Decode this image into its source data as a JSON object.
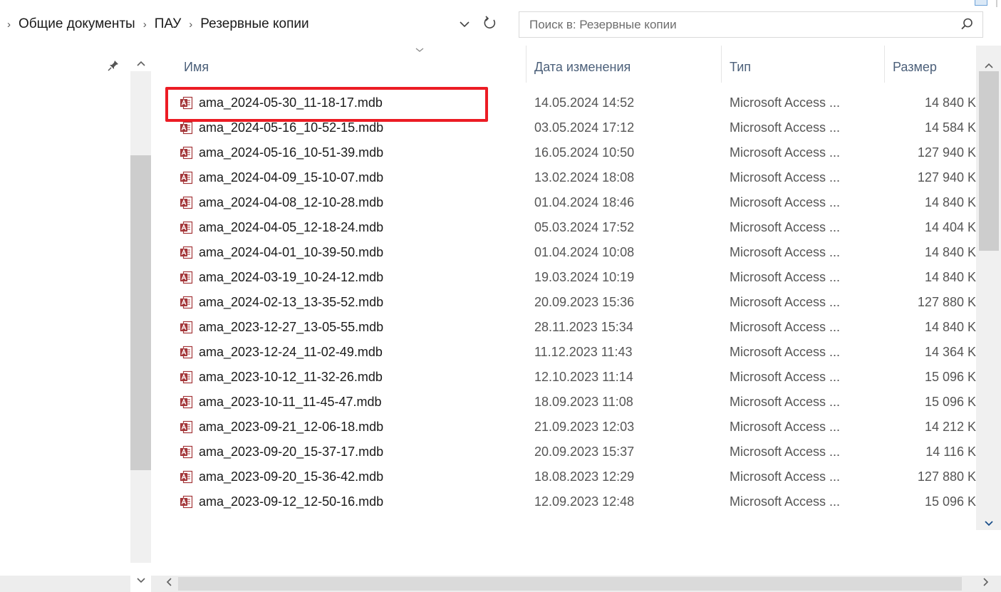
{
  "breadcrumb": {
    "items": [
      "Общие документы",
      "ПАУ",
      "Резервные копии"
    ],
    "separator": "›"
  },
  "search": {
    "placeholder": "Поиск в: Резервные копии"
  },
  "columns": {
    "name": "Имя",
    "date": "Дата изменения",
    "type": "Тип",
    "size": "Размер"
  },
  "files": [
    {
      "name": "ama_2024-05-30_11-18-17.mdb",
      "date": "14.05.2024 14:52",
      "type": "Microsoft Access ...",
      "size": "14 840 K"
    },
    {
      "name": "ama_2024-05-16_10-52-15.mdb",
      "date": "03.05.2024 17:12",
      "type": "Microsoft Access ...",
      "size": "14 584 K"
    },
    {
      "name": "ama_2024-05-16_10-51-39.mdb",
      "date": "16.05.2024 10:50",
      "type": "Microsoft Access ...",
      "size": "127 940 K"
    },
    {
      "name": "ama_2024-04-09_15-10-07.mdb",
      "date": "13.02.2024 18:08",
      "type": "Microsoft Access ...",
      "size": "127 940 K"
    },
    {
      "name": "ama_2024-04-08_12-10-28.mdb",
      "date": "01.04.2024 18:46",
      "type": "Microsoft Access ...",
      "size": "14 840 K"
    },
    {
      "name": "ama_2024-04-05_12-18-24.mdb",
      "date": "05.03.2024 17:52",
      "type": "Microsoft Access ...",
      "size": "14 404 K"
    },
    {
      "name": "ama_2024-04-01_10-39-50.mdb",
      "date": "01.04.2024 10:08",
      "type": "Microsoft Access ...",
      "size": "14 840 K"
    },
    {
      "name": "ama_2024-03-19_10-24-12.mdb",
      "date": "19.03.2024 10:19",
      "type": "Microsoft Access ...",
      "size": "14 840 K"
    },
    {
      "name": "ama_2024-02-13_13-35-52.mdb",
      "date": "20.09.2023 15:36",
      "type": "Microsoft Access ...",
      "size": "127 880 K"
    },
    {
      "name": "ama_2023-12-27_13-05-55.mdb",
      "date": "28.11.2023 15:34",
      "type": "Microsoft Access ...",
      "size": "14 840 K"
    },
    {
      "name": "ama_2023-12-24_11-02-49.mdb",
      "date": "11.12.2023 11:43",
      "type": "Microsoft Access ...",
      "size": "14 364 K"
    },
    {
      "name": "ama_2023-10-12_11-32-26.mdb",
      "date": "12.10.2023 11:14",
      "type": "Microsoft Access ...",
      "size": "15 096 K"
    },
    {
      "name": "ama_2023-10-11_11-45-47.mdb",
      "date": "18.09.2023 11:08",
      "type": "Microsoft Access ...",
      "size": "15 096 K"
    },
    {
      "name": "ama_2023-09-21_12-06-18.mdb",
      "date": "21.09.2023 12:03",
      "type": "Microsoft Access ...",
      "size": "14 212 K"
    },
    {
      "name": "ama_2023-09-20_15-37-17.mdb",
      "date": "20.09.2023 15:37",
      "type": "Microsoft Access ...",
      "size": "14 116 K"
    },
    {
      "name": "ama_2023-09-20_15-36-42.mdb",
      "date": "18.08.2023 12:29",
      "type": "Microsoft Access ...",
      "size": "127 880 K"
    },
    {
      "name": "ama_2023-09-12_12-50-16.mdb",
      "date": "12.09.2023 12:48",
      "type": "Microsoft Access ...",
      "size": "15 096 K"
    }
  ],
  "highlighted_file_index": 0,
  "colors": {
    "highlight": "#ec1c24",
    "header_text": "#4c607a",
    "access_icon": "#a4373a"
  },
  "icons": {
    "file": "access-db-icon",
    "search": "search-icon",
    "refresh": "refresh-icon",
    "dropdown": "chevron-down-icon",
    "pin": "pin-icon"
  }
}
